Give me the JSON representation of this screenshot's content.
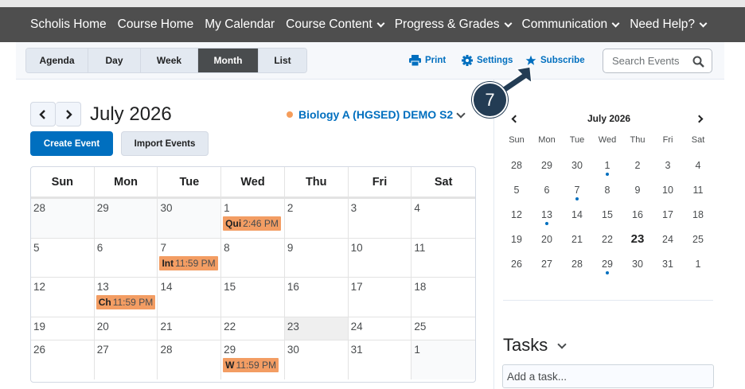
{
  "topnav": {
    "items": [
      {
        "label": "Scholis Home",
        "dropdown": false
      },
      {
        "label": "Course Home",
        "dropdown": false
      },
      {
        "label": "My Calendar",
        "dropdown": false
      },
      {
        "label": "Course Content",
        "dropdown": true
      },
      {
        "label": "Progress & Grades",
        "dropdown": true
      },
      {
        "label": "Communication",
        "dropdown": true
      },
      {
        "label": "Need Help?",
        "dropdown": true
      }
    ]
  },
  "toolbar": {
    "views": [
      "Agenda",
      "Day",
      "Week",
      "Month",
      "List"
    ],
    "active_view": "Month",
    "print_label": "Print",
    "settings_label": "Settings",
    "subscribe_label": "Subscribe",
    "search_placeholder": "Search Events"
  },
  "calendar": {
    "month_title": "July 2026",
    "course_label": "Biology A (HGSED) DEMO S2",
    "create_label": "Create Event",
    "import_label": "Import Events",
    "weekdays": [
      "Sun",
      "Mon",
      "Tue",
      "Wed",
      "Thu",
      "Fri",
      "Sat"
    ],
    "weeks": [
      [
        "28",
        "29",
        "30",
        "1",
        "2",
        "3",
        "4"
      ],
      [
        "5",
        "6",
        "7",
        "8",
        "9",
        "10",
        "11"
      ],
      [
        "12",
        "13",
        "14",
        "15",
        "16",
        "17",
        "18"
      ],
      [
        "19",
        "20",
        "21",
        "22",
        "23",
        "24",
        "25"
      ],
      [
        "26",
        "27",
        "28",
        "29",
        "30",
        "31",
        "1"
      ]
    ],
    "events": [
      {
        "week": 0,
        "day": 3,
        "name": "Qui",
        "time": "2:46 PM"
      },
      {
        "week": 1,
        "day": 2,
        "name": "Int",
        "time": "11:59 PM"
      },
      {
        "week": 2,
        "day": 1,
        "name": "Ch",
        "time": "11:59 PM"
      },
      {
        "week": 4,
        "day": 3,
        "name": "W",
        "time": "11:59 PM"
      }
    ],
    "today": "23"
  },
  "mini_calendar": {
    "title": "July 2026",
    "weekdays": [
      "Sun",
      "Mon",
      "Tue",
      "Wed",
      "Thu",
      "Fri",
      "Sat"
    ],
    "weeks": [
      [
        "28",
        "29",
        "30",
        "1",
        "2",
        "3",
        "4"
      ],
      [
        "5",
        "6",
        "7",
        "8",
        "9",
        "10",
        "11"
      ],
      [
        "12",
        "13",
        "14",
        "15",
        "16",
        "17",
        "18"
      ],
      [
        "19",
        "20",
        "21",
        "22",
        "23",
        "24",
        "25"
      ],
      [
        "26",
        "27",
        "28",
        "29",
        "30",
        "31",
        "1"
      ]
    ],
    "event_days": [
      "1",
      "7",
      "13",
      "29"
    ]
  },
  "tasks": {
    "title": "Tasks",
    "placeholder": "Add a task..."
  },
  "callout": {
    "number": "7"
  },
  "colors": {
    "nav_bg": "#4e4e4e",
    "accent": "#006fbf",
    "event": "#f39d63",
    "badge": "#233c54"
  },
  "icons": [
    "printer-icon",
    "gear-icon",
    "star-icon",
    "search-icon",
    "chevron-left-icon",
    "chevron-right-icon",
    "chevron-down-icon",
    "arrow-icon"
  ]
}
